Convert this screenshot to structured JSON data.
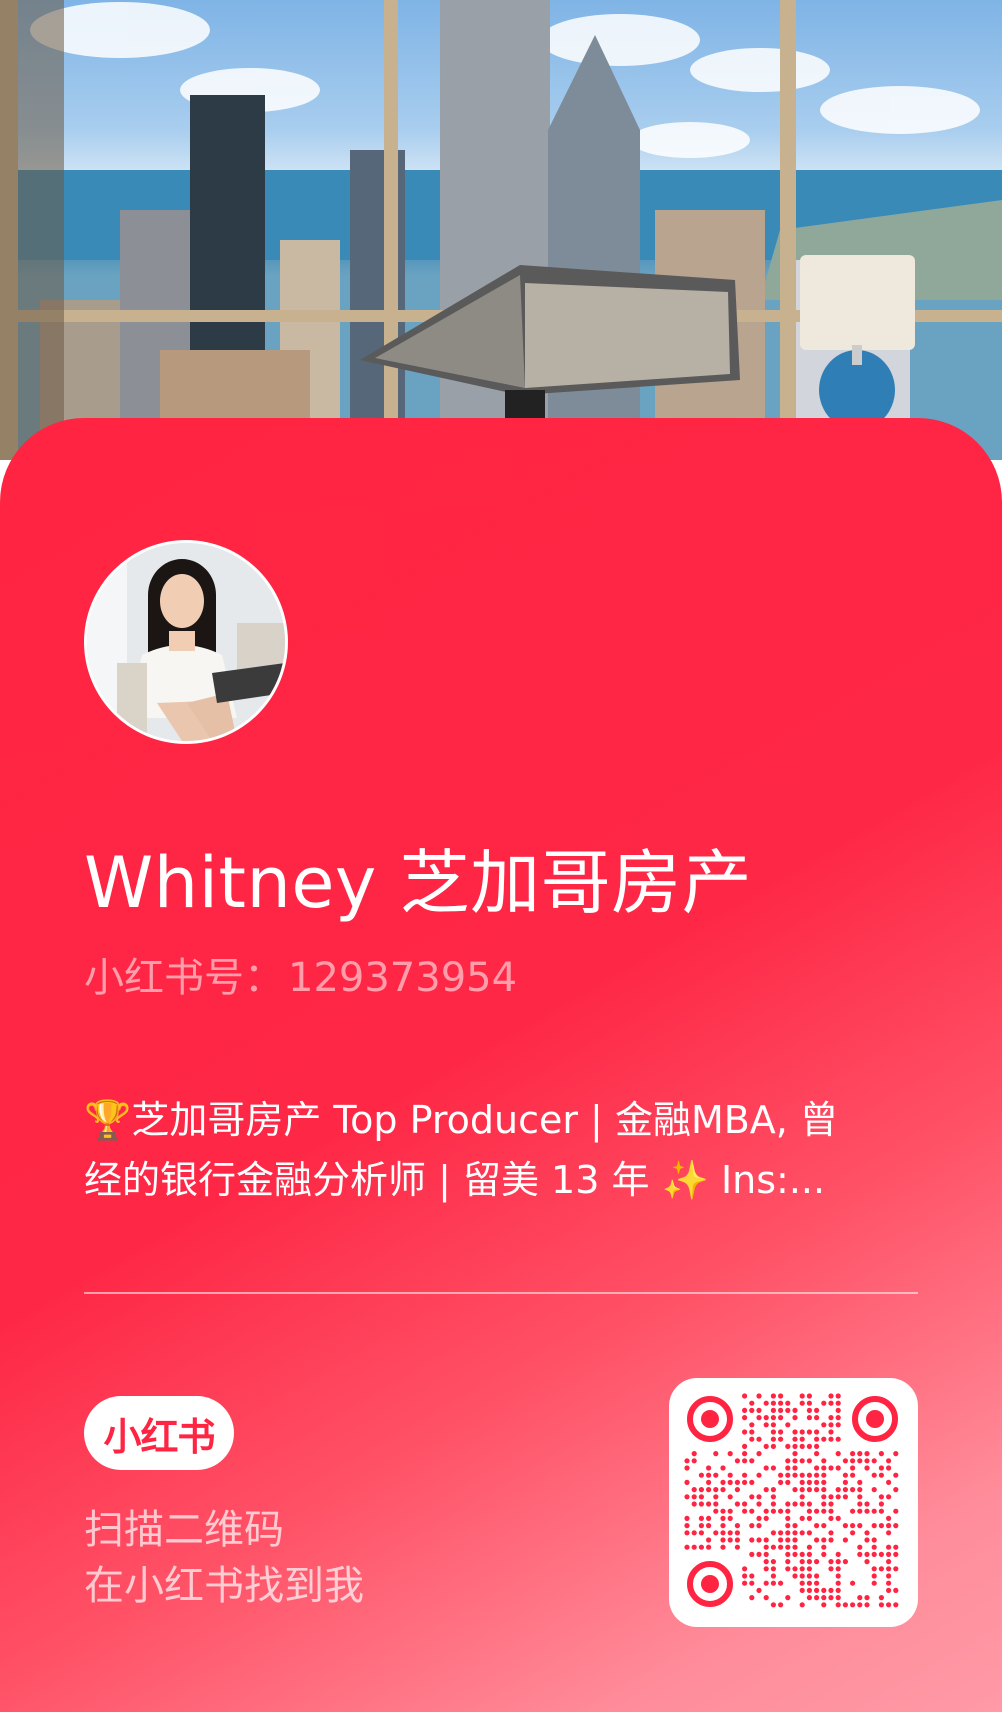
{
  "profile": {
    "name": "Whitney 芝加哥房产",
    "red_id_label": "小红书号：",
    "red_id_value": "129373954",
    "bio_line1": "🏆芝加哥房产 Top Producer | 金融MBA, 曾",
    "bio_line2": "经的银行金融分析师 | 留美 13 年 ✨ Ins:..."
  },
  "footer": {
    "brand_logo_text": "小红书",
    "scan_line1": "扫描二维码",
    "scan_line2": "在小红书找到我"
  },
  "colors": {
    "brand_red": "#ff2442",
    "card_gradient_end": "#ff9aa6",
    "text_white": "#ffffff"
  },
  "icons": {
    "trophy": "trophy-icon",
    "sparkles": "sparkles-icon",
    "qr": "qr-code"
  }
}
